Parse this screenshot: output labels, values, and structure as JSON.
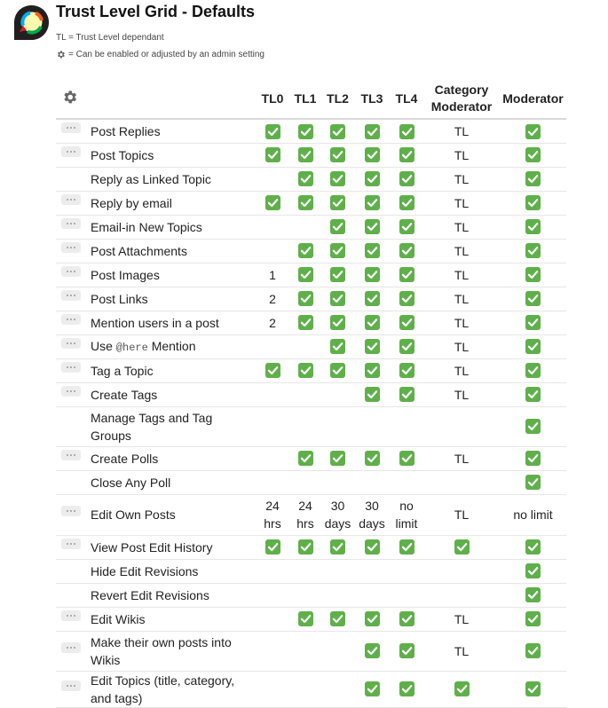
{
  "header": {
    "title": "Trust Level Grid - Defaults",
    "note_tl": "TL = Trust Level dependant",
    "note_gear": "= Can be enabled or adjusted by an admin setting"
  },
  "colors": {
    "check_bg": "#5fb04a",
    "handle_bg": "#ececec"
  },
  "columns": [
    "TL0",
    "TL1",
    "TL2",
    "TL3",
    "TL4",
    "Category Moderator",
    "Moderator"
  ],
  "rows": [
    {
      "feature": "Post Replies",
      "admin_setting": true,
      "cells": [
        "check",
        "check",
        "check",
        "check",
        "check",
        "TL",
        "check"
      ]
    },
    {
      "feature": "Post Topics",
      "admin_setting": true,
      "cells": [
        "check",
        "check",
        "check",
        "check",
        "check",
        "TL",
        "check"
      ]
    },
    {
      "feature": "Reply as Linked Topic",
      "admin_setting": false,
      "cells": [
        "",
        "check",
        "check",
        "check",
        "check",
        "TL",
        "check"
      ]
    },
    {
      "feature": "Reply by email",
      "admin_setting": true,
      "cells": [
        "check",
        "check",
        "check",
        "check",
        "check",
        "TL",
        "check"
      ]
    },
    {
      "feature": "Email-in New Topics",
      "admin_setting": true,
      "cells": [
        "",
        "",
        "check",
        "check",
        "check",
        "TL",
        "check"
      ]
    },
    {
      "feature": "Post Attachments",
      "admin_setting": true,
      "cells": [
        "",
        "check",
        "check",
        "check",
        "check",
        "TL",
        "check"
      ]
    },
    {
      "feature": "Post Images",
      "admin_setting": true,
      "cells": [
        "1",
        "check",
        "check",
        "check",
        "check",
        "TL",
        "check"
      ]
    },
    {
      "feature": "Post Links",
      "admin_setting": true,
      "cells": [
        "2",
        "check",
        "check",
        "check",
        "check",
        "TL",
        "check"
      ]
    },
    {
      "feature": "Mention users in a post",
      "admin_setting": true,
      "cells": [
        "2",
        "check",
        "check",
        "check",
        "check",
        "TL",
        "check"
      ]
    },
    {
      "feature_pre": "Use ",
      "feature_code": "@here",
      "feature_post": " Mention",
      "admin_setting": true,
      "cells": [
        "",
        "",
        "check",
        "check",
        "check",
        "TL",
        "check"
      ]
    },
    {
      "feature": "Tag a Topic",
      "admin_setting": true,
      "cells": [
        "check",
        "check",
        "check",
        "check",
        "check",
        "TL",
        "check"
      ]
    },
    {
      "feature": "Create Tags",
      "admin_setting": true,
      "cells": [
        "",
        "",
        "",
        "check",
        "check",
        "TL",
        "check"
      ]
    },
    {
      "feature": "Manage Tags and Tag Groups",
      "admin_setting": false,
      "cells": [
        "",
        "",
        "",
        "",
        "",
        "",
        "check"
      ]
    },
    {
      "feature": "Create Polls",
      "admin_setting": true,
      "cells": [
        "",
        "check",
        "check",
        "check",
        "check",
        "TL",
        "check"
      ]
    },
    {
      "feature": "Close Any Poll",
      "admin_setting": false,
      "cells": [
        "",
        "",
        "",
        "",
        "",
        "",
        "check"
      ]
    },
    {
      "feature": "Edit Own Posts",
      "admin_setting": true,
      "cells": [
        "24 hrs",
        "24 hrs",
        "30 days",
        "30 days",
        "no limit",
        "TL",
        "no limit"
      ]
    },
    {
      "feature": "View Post Edit History",
      "admin_setting": true,
      "cells": [
        "check",
        "check",
        "check",
        "check",
        "check",
        "check",
        "check"
      ]
    },
    {
      "feature": "Hide Edit Revisions",
      "admin_setting": false,
      "cells": [
        "",
        "",
        "",
        "",
        "",
        "",
        "check"
      ]
    },
    {
      "feature": "Revert Edit Revisions",
      "admin_setting": false,
      "cells": [
        "",
        "",
        "",
        "",
        "",
        "",
        "check"
      ]
    },
    {
      "feature": "Edit Wikis",
      "admin_setting": true,
      "cells": [
        "",
        "check",
        "check",
        "check",
        "check",
        "TL",
        "check"
      ]
    },
    {
      "feature": "Make their own posts into Wikis",
      "admin_setting": true,
      "cells": [
        "",
        "",
        "",
        "check",
        "check",
        "TL",
        "check"
      ]
    },
    {
      "feature": "Edit Topics (title, category, and tags)",
      "admin_setting": true,
      "cells": [
        "",
        "",
        "",
        "check",
        "check",
        "check",
        "check"
      ]
    }
  ]
}
